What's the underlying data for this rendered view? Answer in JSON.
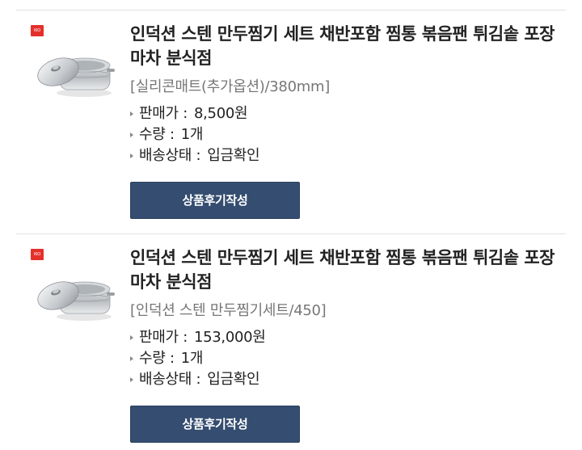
{
  "orders": [
    {
      "brand_logo": "KIO",
      "title": "인덕션 스텐 만두찜기 세트 채반포함 찜통 볶음팬 튀김솥 포장마차 분식점",
      "option": "[실리콘매트(추가옵션)/380mm]",
      "price_label": "판매가 :",
      "price_value": "8,500원",
      "qty_label": "수량 :",
      "qty_value": "1개",
      "status_label": "배송상태 :",
      "status_value": "입금확인",
      "review_label": "상품후기작성"
    },
    {
      "brand_logo": "KIO",
      "title": "인덕션 스텐 만두찜기 세트 채반포함 찜통 볶음팬 튀김솥 포장마차 분식점",
      "option": "[인덕션 스텐 만두찜기세트/450]",
      "price_label": "판매가 :",
      "price_value": "153,000원",
      "qty_label": "수량 :",
      "qty_value": "1개",
      "status_label": "배송상태 :",
      "status_value": "입금확인",
      "review_label": "상품후기작성"
    }
  ],
  "colors": {
    "button_bg": "#344d70",
    "brand_red": "#e4302b",
    "option_text": "#777777"
  },
  "icons": {
    "bullet": "triangle-bullet-icon",
    "product": "steamer-pot-image"
  }
}
